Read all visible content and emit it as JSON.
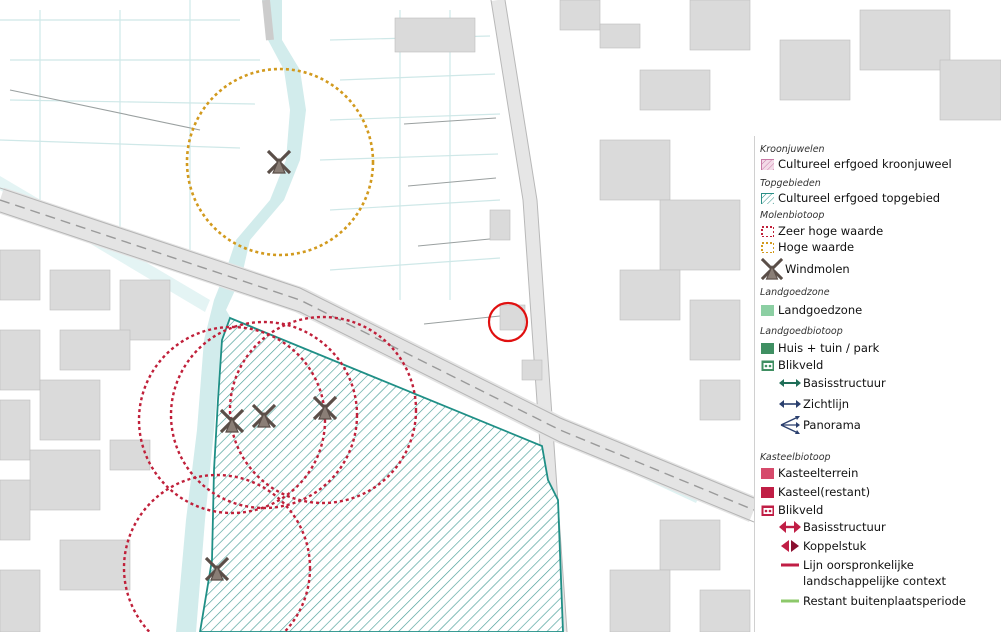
{
  "map": {
    "colors": {
      "background": "#ffffff",
      "water": "#d2ecec",
      "buildings": "#dadada",
      "roads": "#e6e6e6",
      "topgebied_outline": "#1f8f86",
      "topgebied_hatch": "#4a9f99",
      "zeer_hoge_waarde": "#c0203a",
      "hoge_waarde": "#d29a1e",
      "highlight_circle": "#e01010",
      "windmill": "#5a4e48"
    },
    "windmills": 5
  },
  "legend": {
    "sections": [
      {
        "title": "Kroonjuwelen",
        "items": [
          {
            "label": "Cultureel erfgoed kroonjuweel",
            "symbol": "pink-hatch-icon"
          }
        ]
      },
      {
        "title": "Topgebieden",
        "items": [
          {
            "label": "Cultureel erfgoed topgebied",
            "symbol": "teal-hatch-icon"
          }
        ]
      },
      {
        "title": "Molenbiotoop",
        "items": [
          {
            "label": "Zeer hoge waarde",
            "symbol": "red-dotted-box-icon"
          },
          {
            "label": "Hoge waarde",
            "symbol": "orange-dotted-box-icon"
          },
          {
            "label": "Windmolen",
            "symbol": "windmill-icon"
          }
        ]
      },
      {
        "title": "Landgoedzone",
        "items": [
          {
            "label": "Landgoedzone",
            "symbol": "light-green-square-icon"
          }
        ]
      },
      {
        "title": "Landgoedbiotoop",
        "items": [
          {
            "label": "Huis + tuin / park",
            "symbol": "dark-green-square-icon"
          },
          {
            "label": "Blikveld",
            "symbol": "green-blikveld-icon"
          },
          {
            "label": "Basisstructuur",
            "symbol": "green-double-arrow-icon"
          },
          {
            "label": "Zichtlijn",
            "symbol": "navy-double-arrow-icon"
          },
          {
            "label": "Panorama",
            "symbol": "navy-fan-arrows-icon"
          }
        ]
      },
      {
        "title": "Kasteelbiotoop",
        "items": [
          {
            "label": "Kasteelterrein",
            "symbol": "pink-square-icon"
          },
          {
            "label": "Kasteel(restant)",
            "symbol": "crimson-square-icon"
          },
          {
            "label": "Blikveld",
            "symbol": "crimson-blikveld-icon"
          },
          {
            "label": "Basisstructuur",
            "symbol": "crimson-double-arrow-icon"
          },
          {
            "label": "Koppelstuk",
            "symbol": "crimson-coupling-icon"
          },
          {
            "label": "Lijn oorspronkelijke",
            "label2": "landschappelijke context",
            "symbol": "crimson-line-icon"
          },
          {
            "label": "Restant buitenplaatsperiode",
            "symbol": "green-line-icon"
          }
        ]
      }
    ],
    "colors": {
      "kroonjuweel": "#c87aa6",
      "topgebied": "#2a8f86",
      "landgoedzone": "#8ccfa3",
      "huis_tuin_park": "#3f8f62",
      "landgoed_arrow": "#1f6e58",
      "zichtlijn": "#2a3f6e",
      "kasteelterrein": "#d64a6b",
      "kasteel": "#c01e45",
      "restant": "#8cc86a"
    }
  }
}
